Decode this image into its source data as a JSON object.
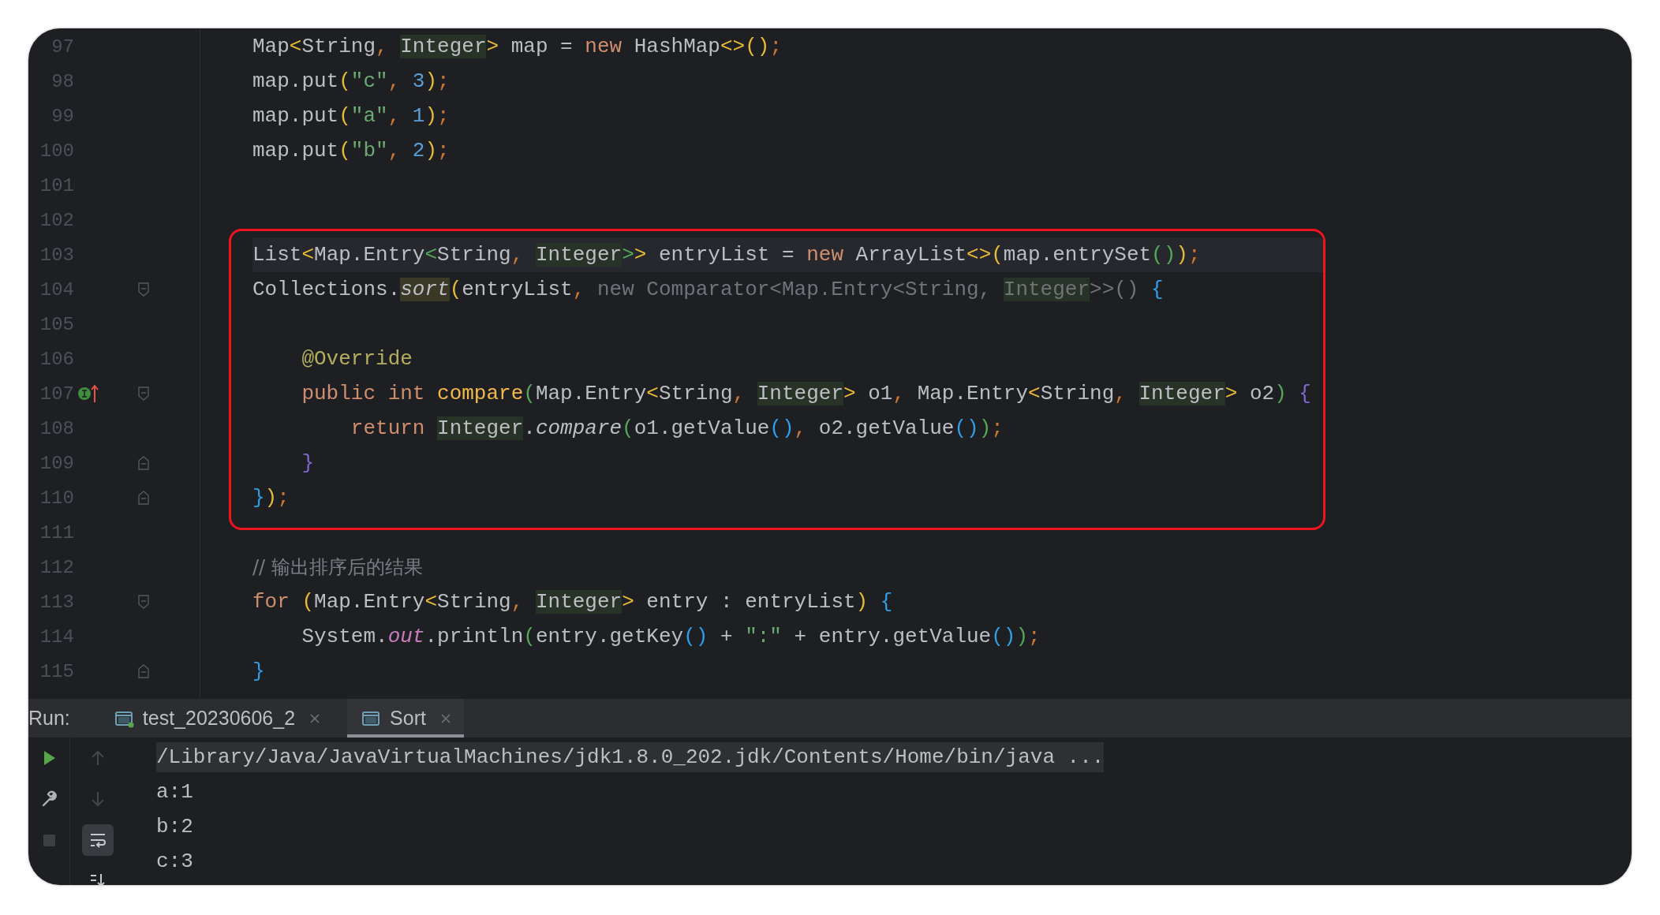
{
  "editor": {
    "blocks": [
      {
        "boxed": false,
        "lines": [
          {
            "number": "97",
            "current": false,
            "fold_start": false,
            "fold_end": false,
            "implements_marker": false,
            "tokens": [
              {
                "text": "Map",
                "kind": "plain"
              },
              {
                "text": "<",
                "kind": "bracket1"
              },
              {
                "text": "String",
                "kind": "plain"
              },
              {
                "text": ", ",
                "kind": "punct"
              },
              {
                "text": "Integer",
                "kind": "type_ref"
              },
              {
                "text": ">",
                "kind": "bracket1"
              },
              {
                "text": " map = ",
                "kind": "plain"
              },
              {
                "text": "new",
                "kind": "keyword"
              },
              {
                "text": " HashMap",
                "kind": "plain"
              },
              {
                "text": "<>()",
                "kind": "bracket1"
              },
              {
                "text": ";",
                "kind": "punct"
              }
            ]
          },
          {
            "number": "98",
            "current": false,
            "fold_start": false,
            "fold_end": false,
            "implements_marker": false,
            "tokens": [
              {
                "text": "map.put",
                "kind": "plain"
              },
              {
                "text": "(",
                "kind": "bracket1"
              },
              {
                "text": "\"c\"",
                "kind": "string"
              },
              {
                "text": ", ",
                "kind": "punct"
              },
              {
                "text": "3",
                "kind": "number"
              },
              {
                "text": ")",
                "kind": "bracket1"
              },
              {
                "text": ";",
                "kind": "punct"
              }
            ]
          },
          {
            "number": "99",
            "current": false,
            "fold_start": false,
            "fold_end": false,
            "implements_marker": false,
            "tokens": [
              {
                "text": "map.put",
                "kind": "plain"
              },
              {
                "text": "(",
                "kind": "bracket1"
              },
              {
                "text": "\"a\"",
                "kind": "string"
              },
              {
                "text": ", ",
                "kind": "punct"
              },
              {
                "text": "1",
                "kind": "number"
              },
              {
                "text": ")",
                "kind": "bracket1"
              },
              {
                "text": ";",
                "kind": "punct"
              }
            ]
          },
          {
            "number": "100",
            "current": false,
            "fold_start": false,
            "fold_end": false,
            "implements_marker": false,
            "tokens": [
              {
                "text": "map.put",
                "kind": "plain"
              },
              {
                "text": "(",
                "kind": "bracket1"
              },
              {
                "text": "\"b\"",
                "kind": "string"
              },
              {
                "text": ", ",
                "kind": "punct"
              },
              {
                "text": "2",
                "kind": "number"
              },
              {
                "text": ")",
                "kind": "bracket1"
              },
              {
                "text": ";",
                "kind": "punct"
              }
            ]
          },
          {
            "number": "101",
            "current": false,
            "fold_start": false,
            "fold_end": false,
            "implements_marker": false
          },
          {
            "number": "102",
            "current": false,
            "fold_start": false,
            "fold_end": false,
            "implements_marker": false
          }
        ]
      },
      {
        "boxed": true,
        "lines": [
          {
            "number": "103",
            "current": true,
            "fold_start": false,
            "fold_end": false,
            "implements_marker": false,
            "tokens": [
              {
                "text": "List",
                "kind": "plain"
              },
              {
                "text": "<",
                "kind": "bracket1"
              },
              {
                "text": "Map.Entry",
                "kind": "plain"
              },
              {
                "text": "<",
                "kind": "bracket3"
              },
              {
                "text": "String",
                "kind": "plain"
              },
              {
                "text": ", ",
                "kind": "punct"
              },
              {
                "text": "Integer",
                "kind": "type_ref"
              },
              {
                "text": ">",
                "kind": "bracket3"
              },
              {
                "text": ">",
                "kind": "bracket1"
              },
              {
                "text": " entryList = ",
                "kind": "plain"
              },
              {
                "text": "new",
                "kind": "keyword"
              },
              {
                "text": " ArrayList",
                "kind": "plain"
              },
              {
                "text": "<>(",
                "kind": "bracket1"
              },
              {
                "text": "map.entrySet",
                "kind": "plain"
              },
              {
                "text": "()",
                "kind": "bracket3"
              },
              {
                "text": ")",
                "kind": "bracket1"
              },
              {
                "text": ";",
                "kind": "punct"
              }
            ]
          },
          {
            "number": "104",
            "current": false,
            "fold_start": true,
            "fold_end": false,
            "implements_marker": false,
            "tokens": [
              {
                "text": "Collections.",
                "kind": "plain"
              },
              {
                "text": "sort",
                "kind": "usage_call"
              },
              {
                "text": "(",
                "kind": "bracket1"
              },
              {
                "text": "entryList",
                "kind": "plain"
              },
              {
                "text": ", ",
                "kind": "punct"
              },
              {
                "text": "new Comparator<Map.Entry<String, ",
                "kind": "dim"
              },
              {
                "text": "Integer",
                "kind": "dim_type_ref"
              },
              {
                "text": ">>() ",
                "kind": "dim"
              },
              {
                "text": "{",
                "kind": "bracket2"
              }
            ]
          },
          {
            "number": "105",
            "current": false,
            "fold_start": false,
            "fold_end": false,
            "implements_marker": false
          },
          {
            "number": "106",
            "current": false,
            "fold_start": false,
            "fold_end": false,
            "implements_marker": false,
            "tokens": [
              {
                "text": "    @Override",
                "kind": "annotation"
              }
            ]
          },
          {
            "number": "107",
            "current": false,
            "fold_start": true,
            "fold_end": false,
            "implements_marker": true,
            "tokens": [
              {
                "text": "    public int ",
                "kind": "keyword"
              },
              {
                "text": "compare",
                "kind": "method"
              },
              {
                "text": "(",
                "kind": "bracket3"
              },
              {
                "text": "Map.Entry",
                "kind": "plain"
              },
              {
                "text": "<",
                "kind": "bracket1"
              },
              {
                "text": "String",
                "kind": "plain"
              },
              {
                "text": ", ",
                "kind": "punct"
              },
              {
                "text": "Integer",
                "kind": "type_ref"
              },
              {
                "text": ">",
                "kind": "bracket1"
              },
              {
                "text": " o1",
                "kind": "plain"
              },
              {
                "text": ", ",
                "kind": "punct"
              },
              {
                "text": "Map.Entry",
                "kind": "plain"
              },
              {
                "text": "<",
                "kind": "bracket1"
              },
              {
                "text": "String",
                "kind": "plain"
              },
              {
                "text": ", ",
                "kind": "punct"
              },
              {
                "text": "Integer",
                "kind": "type_ref"
              },
              {
                "text": ">",
                "kind": "bracket1"
              },
              {
                "text": " o2",
                "kind": "plain"
              },
              {
                "text": ")",
                "kind": "bracket3"
              },
              {
                "text": " {",
                "kind": "bracket4"
              }
            ]
          },
          {
            "number": "108",
            "current": false,
            "fold_start": false,
            "fold_end": false,
            "implements_marker": false,
            "tokens": [
              {
                "text": "        return ",
                "kind": "keyword"
              },
              {
                "text": "Integer",
                "kind": "type_ref"
              },
              {
                "text": ".",
                "kind": "plain"
              },
              {
                "text": "compare",
                "kind": "static_call"
              },
              {
                "text": "(",
                "kind": "bracket3"
              },
              {
                "text": "o1.getValue",
                "kind": "plain"
              },
              {
                "text": "()",
                "kind": "bracket2"
              },
              {
                "text": ", ",
                "kind": "punct"
              },
              {
                "text": "o2.getValue",
                "kind": "plain"
              },
              {
                "text": "()",
                "kind": "bracket2"
              },
              {
                "text": ")",
                "kind": "bracket3"
              },
              {
                "text": ";",
                "kind": "punct"
              }
            ]
          },
          {
            "number": "109",
            "current": false,
            "fold_start": false,
            "fold_end": true,
            "implements_marker": false,
            "tokens": [
              {
                "text": "    }",
                "kind": "bracket4"
              }
            ]
          },
          {
            "number": "110",
            "current": false,
            "fold_start": false,
            "fold_end": true,
            "implements_marker": false,
            "tokens": [
              {
                "text": "}",
                "kind": "bracket2"
              },
              {
                "text": ")",
                "kind": "bracket1"
              },
              {
                "text": ";",
                "kind": "punct"
              }
            ]
          }
        ]
      },
      {
        "boxed": false,
        "lines": [
          {
            "number": "111",
            "current": false,
            "fold_start": false,
            "fold_end": false,
            "implements_marker": false
          },
          {
            "number": "112",
            "current": false,
            "fold_start": false,
            "fold_end": false,
            "implements_marker": false,
            "tokens": [
              {
                "text": "// 输出排序后的结果",
                "kind": "comment"
              }
            ]
          },
          {
            "number": "113",
            "current": false,
            "fold_start": true,
            "fold_end": false,
            "implements_marker": false,
            "tokens": [
              {
                "text": "for ",
                "kind": "keyword"
              },
              {
                "text": "(",
                "kind": "bracket1"
              },
              {
                "text": "Map.Entry",
                "kind": "plain"
              },
              {
                "text": "<",
                "kind": "bracket1"
              },
              {
                "text": "String",
                "kind": "plain"
              },
              {
                "text": ", ",
                "kind": "punct"
              },
              {
                "text": "Integer",
                "kind": "type_ref"
              },
              {
                "text": ">",
                "kind": "bracket1"
              },
              {
                "text": " entry : entryList",
                "kind": "plain"
              },
              {
                "text": ")",
                "kind": "bracket1"
              },
              {
                "text": " {",
                "kind": "bracket2"
              }
            ]
          },
          {
            "number": "114",
            "current": false,
            "fold_start": false,
            "fold_end": false,
            "implements_marker": false,
            "tokens": [
              {
                "text": "    System.",
                "kind": "plain"
              },
              {
                "text": "out",
                "kind": "static_field"
              },
              {
                "text": ".println",
                "kind": "plain"
              },
              {
                "text": "(",
                "kind": "bracket3"
              },
              {
                "text": "entry.getKey",
                "kind": "plain"
              },
              {
                "text": "()",
                "kind": "bracket2"
              },
              {
                "text": " + ",
                "kind": "plain"
              },
              {
                "text": "\":\"",
                "kind": "string"
              },
              {
                "text": " + entry.getValue",
                "kind": "plain"
              },
              {
                "text": "()",
                "kind": "bracket2"
              },
              {
                "text": ")",
                "kind": "bracket3"
              },
              {
                "text": ";",
                "kind": "punct"
              }
            ]
          },
          {
            "number": "115",
            "current": false,
            "fold_start": false,
            "fold_end": true,
            "implements_marker": false,
            "tokens": [
              {
                "text": "}",
                "kind": "bracket2"
              }
            ]
          }
        ]
      }
    ]
  },
  "run_panel": {
    "label": "Run:",
    "tabs": [
      {
        "title": "test_20230606_2",
        "selected": false,
        "running": true
      },
      {
        "title": "Sort",
        "selected": true,
        "running": false
      }
    ],
    "toolbar": [
      [
        {
          "kind": "rerun",
          "disabled": false,
          "toggled": false
        },
        {
          "kind": "settings",
          "disabled": false,
          "toggled": false
        },
        {
          "kind": "stop",
          "disabled": true,
          "toggled": false
        }
      ],
      [
        {
          "kind": "up",
          "disabled": true,
          "toggled": false
        },
        {
          "kind": "down",
          "disabled": true,
          "toggled": false
        },
        {
          "kind": "soft_wrap",
          "disabled": false,
          "toggled": true
        },
        {
          "kind": "scroll_end",
          "disabled": false,
          "toggled": false
        }
      ]
    ],
    "output": [
      {
        "text": "/Library/Java/JavaVirtualMachines/jdk1.8.0_202.jdk/Contents/Home/bin/java ...",
        "kind": "command"
      },
      {
        "text": "a:1",
        "kind": "stdout"
      },
      {
        "text": "b:2",
        "kind": "stdout"
      },
      {
        "text": "c:3",
        "kind": "stdout"
      }
    ]
  }
}
